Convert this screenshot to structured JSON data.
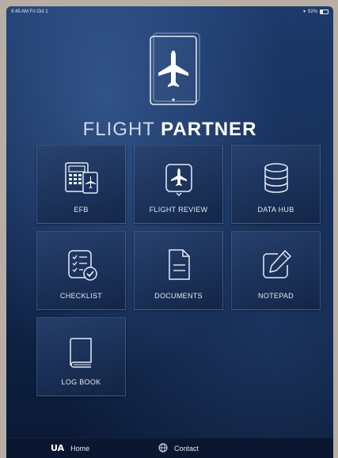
{
  "status_bar": {
    "time_date": "9:45 AM  Fri Oct 1",
    "battery": "92%"
  },
  "brand": {
    "title_light": "FLIGHT",
    "title_bold": "PARTNER"
  },
  "tiles": [
    {
      "label": "EFB",
      "icon": "efb-icon"
    },
    {
      "label": "FLIGHT REVIEW",
      "icon": "airplane-tablet-icon"
    },
    {
      "label": "DATA HUB",
      "icon": "database-icon"
    },
    {
      "label": "CHECKLIST",
      "icon": "checklist-icon"
    },
    {
      "label": "DOCUMENTS",
      "icon": "document-icon"
    },
    {
      "label": "NOTEPAD",
      "icon": "notepad-pencil-icon"
    },
    {
      "label": "LOG BOOK",
      "icon": "book-icon"
    }
  ],
  "bottom_nav": {
    "logo": "UA",
    "home_label": "Home",
    "contact_label": "Contact"
  }
}
